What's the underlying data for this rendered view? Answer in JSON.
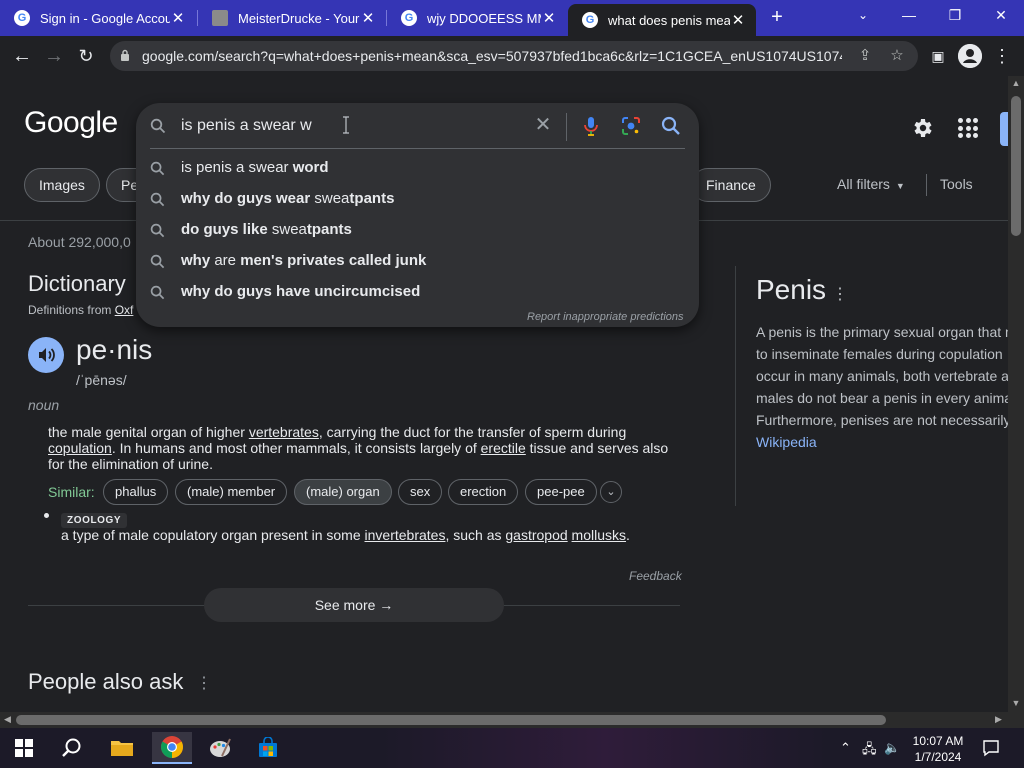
{
  "browser": {
    "tabs": [
      {
        "title": "Sign in - Google Accounts",
        "favicon": "google-g-icon",
        "active": false
      },
      {
        "title": "MeisterDrucke - Your fine art prints",
        "favicon": "meisterdrucke-icon",
        "active": false
      },
      {
        "title": "wjy DDOOEESS MMYY",
        "favicon": "google-g-icon",
        "active": false
      },
      {
        "title": "what does penis mean - Google Search",
        "favicon": "google-g-icon",
        "active": true
      }
    ],
    "url": "google.com/search?q=what+does+penis+mean&sca_esv=507937bfed1bca6c&rlz=1C1GCEA_enUS1074US1074...",
    "accent": "#3535b5"
  },
  "search": {
    "query": "is penis a swear w",
    "suggestions": [
      {
        "plain": "is penis a swear ",
        "bold": "word",
        "bold_first": false
      },
      {
        "plain": "why do guys wear ",
        "bold": "sweatpants",
        "bold_first": true,
        "prefix": "why do guys wear ",
        "mid": "swea",
        "suffix": "tpants"
      },
      {
        "prefix": "do guys like ",
        "mid": "swea",
        "suffix": "tpants"
      },
      {
        "prefix": "why ",
        "mid": "are",
        "suffix": " men's privates called junk"
      },
      {
        "prefix": "why do guys have uncircumcised",
        "mid": "",
        "suffix": ""
      }
    ],
    "report_label": "Report inappropriate predictions"
  },
  "header": {
    "logo": "Google",
    "chips": [
      "Images",
      "Pe",
      "Finance"
    ],
    "all_filters": "All filters",
    "tools": "Tools"
  },
  "results": {
    "stats": "About 292,000,0",
    "dictionary": {
      "title": "Dictionary",
      "source_prefix": "Definitions from ",
      "source_link": "Oxf",
      "word": "pe·nis",
      "phonetic": "/ˈpēnəs/",
      "part_of_speech": "noun",
      "definition_1": {
        "a": "the male genital organ of higher ",
        "b": "vertebrates",
        "c": ", carrying the duct for the transfer of sperm during ",
        "d": "copulation",
        "e": ". In humans and most other mammals, it consists largely of ",
        "f": "erectile",
        "g": " tissue and serves also for the elimination of urine."
      },
      "similar_label": "Similar:",
      "similar": [
        "phallus",
        "(male) member",
        "(male) organ",
        "sex",
        "erection",
        "pee-pee"
      ],
      "zoology_label": "ZOOLOGY",
      "definition_2": {
        "a": "a type of male copulatory organ present in some ",
        "b": "invertebrates",
        "c": ", such as ",
        "d": "gastropod",
        "e": " ",
        "f": "mollusks",
        "g": "."
      },
      "feedback": "Feedback",
      "see_more": "See more"
    },
    "people_also_ask": "People also ask"
  },
  "knowledge_panel": {
    "title": "Penis",
    "lines": [
      "A penis is the primary sexual organ that m",
      "to inseminate females during copulation",
      "occur in many animals, both vertebrate a",
      "males do not bear a penis in every anima",
      "Furthermore, penises are not necessarily"
    ],
    "source": "Wikipedia"
  },
  "taskbar": {
    "time": "10:07 AM",
    "date": "1/7/2024"
  }
}
